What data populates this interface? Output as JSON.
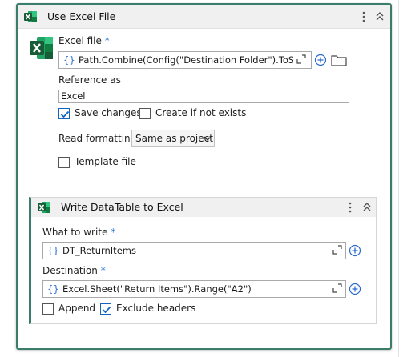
{
  "use_excel": {
    "title": "Use Excel File",
    "excel_file_label": "Excel file",
    "required_mark": "*",
    "excel_file_value": "Path.Combine(Config(\"Destination Folder\").ToStrin",
    "expression_marker": "{}",
    "reference_label": "Reference as",
    "reference_value": "Excel",
    "save_changes_label": "Save changes",
    "save_changes_checked": true,
    "create_if_not_exists_label": "Create if not exists",
    "create_if_not_exists_checked": false,
    "read_formatting_label": "Read formatting",
    "read_formatting_value": "Same as project",
    "template_file_label": "Template file",
    "template_file_checked": false
  },
  "write_datatable": {
    "title": "Write DataTable to Excel",
    "what_to_write_label": "What to write",
    "what_to_write_value": "DT_ReturnItems",
    "destination_label": "Destination",
    "destination_value": "Excel.Sheet(\"Return Items\").Range(\"A2\")",
    "append_label": "Append",
    "append_checked": false,
    "exclude_headers_label": "Exclude headers",
    "exclude_headers_checked": true
  },
  "colors": {
    "accent_green": "#3a7d6a",
    "excel_green": "#1d6f42",
    "link_blue": "#1e6fd9"
  }
}
